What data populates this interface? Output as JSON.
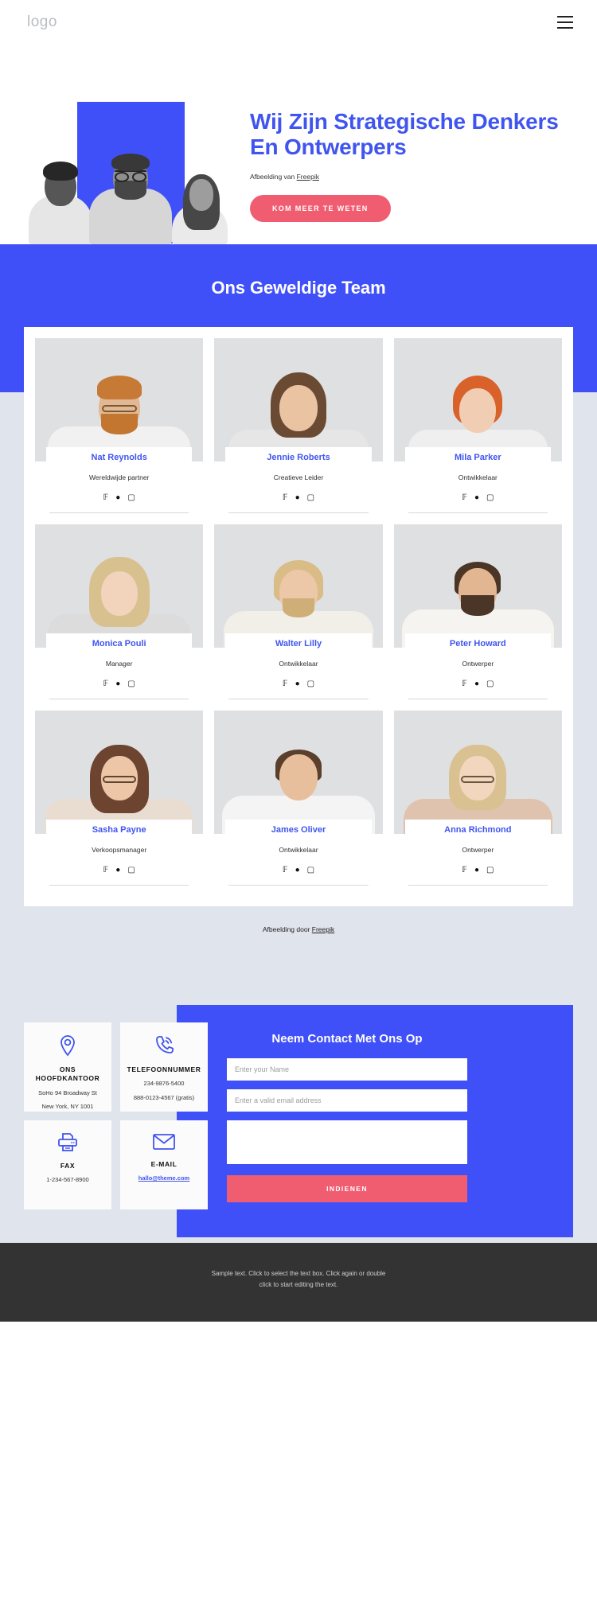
{
  "header": {
    "logo": "logo",
    "menu_icon": "hamburger-icon"
  },
  "hero": {
    "title": "Wij Zijn Strategische Denkers En Ontwerpers",
    "credit_prefix": "Afbeelding van ",
    "credit_link": "Freepik",
    "cta_label": "KOM MEER TE WETEN",
    "accent_color": "#4055ef",
    "cta_color": "#f05d71"
  },
  "team": {
    "heading": "Ons Geweldige Team",
    "band_color": "#4050f8",
    "credit_prefix": "Afbeelding door ",
    "credit_link": "Freepik",
    "social_icons": [
      "facebook-icon",
      "twitter-icon",
      "instagram-icon"
    ],
    "members": [
      {
        "name": "Nat Reynolds",
        "role": "Wereldwijde partner"
      },
      {
        "name": "Jennie Roberts",
        "role": "Creatieve Leider"
      },
      {
        "name": "Mila Parker",
        "role": "Ontwikkelaar"
      },
      {
        "name": "Monica Pouli",
        "role": "Manager"
      },
      {
        "name": "Walter Lilly",
        "role": "Ontwikkelaar"
      },
      {
        "name": "Peter Howard",
        "role": "Ontwerper"
      },
      {
        "name": "Sasha Payne",
        "role": "Verkoopsmanager"
      },
      {
        "name": "James Oliver",
        "role": "Ontwikkelaar"
      },
      {
        "name": "Anna Richmond",
        "role": "Ontwerper"
      }
    ]
  },
  "contact": {
    "cards": [
      {
        "icon": "location-pin-icon",
        "title": "ONS HOOFDKANTOOR",
        "line1": "SoHo 94 Broadway St",
        "line2": "New York, NY 1001"
      },
      {
        "icon": "phone-icon",
        "title": "TELEFOONNUMMER",
        "line1": "234-9876-5400",
        "line2": "888-0123-4567 (gratis)"
      },
      {
        "icon": "fax-printer-icon",
        "title": "FAX",
        "line1": "1-234-567-8900",
        "line2": ""
      },
      {
        "icon": "envelope-icon",
        "title": "E-MAIL",
        "line1": "hallo@theme.com",
        "line2": ""
      }
    ],
    "form": {
      "title": "Neem Contact Met Ons Op",
      "name_placeholder": "Enter your Name",
      "name_value": "",
      "email_placeholder": "Enter a valid email address",
      "email_value": "",
      "message_placeholder": "",
      "message_value": "",
      "submit_label": "INDIENEN"
    }
  },
  "footer": {
    "line1": "Sample text. Click to select the text box. Click again or double",
    "line2": "click to start editing the text."
  }
}
